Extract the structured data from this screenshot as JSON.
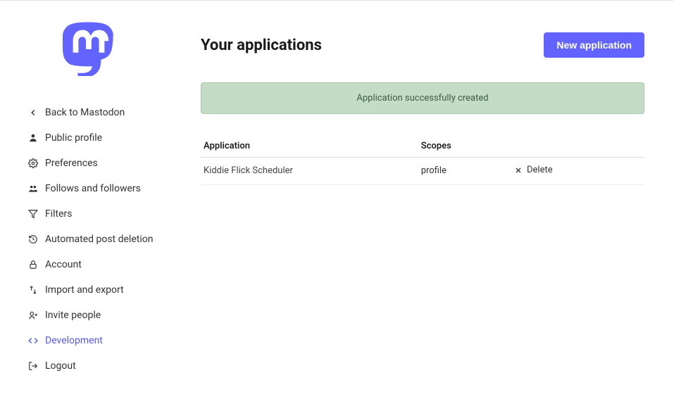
{
  "sidebar": {
    "items": [
      {
        "label": "Back to Mastodon"
      },
      {
        "label": "Public profile"
      },
      {
        "label": "Preferences"
      },
      {
        "label": "Follows and followers"
      },
      {
        "label": "Filters"
      },
      {
        "label": "Automated post deletion"
      },
      {
        "label": "Account"
      },
      {
        "label": "Import and export"
      },
      {
        "label": "Invite people"
      },
      {
        "label": "Development"
      },
      {
        "label": "Logout"
      }
    ]
  },
  "header": {
    "title": "Your applications",
    "new_button": "New application"
  },
  "flash": {
    "message": "Application successfully created"
  },
  "table": {
    "headers": {
      "application": "Application",
      "scopes": "Scopes"
    },
    "rows": [
      {
        "name": "Kiddie Flick Scheduler",
        "scopes": "profile",
        "delete_label": "Delete"
      }
    ]
  }
}
